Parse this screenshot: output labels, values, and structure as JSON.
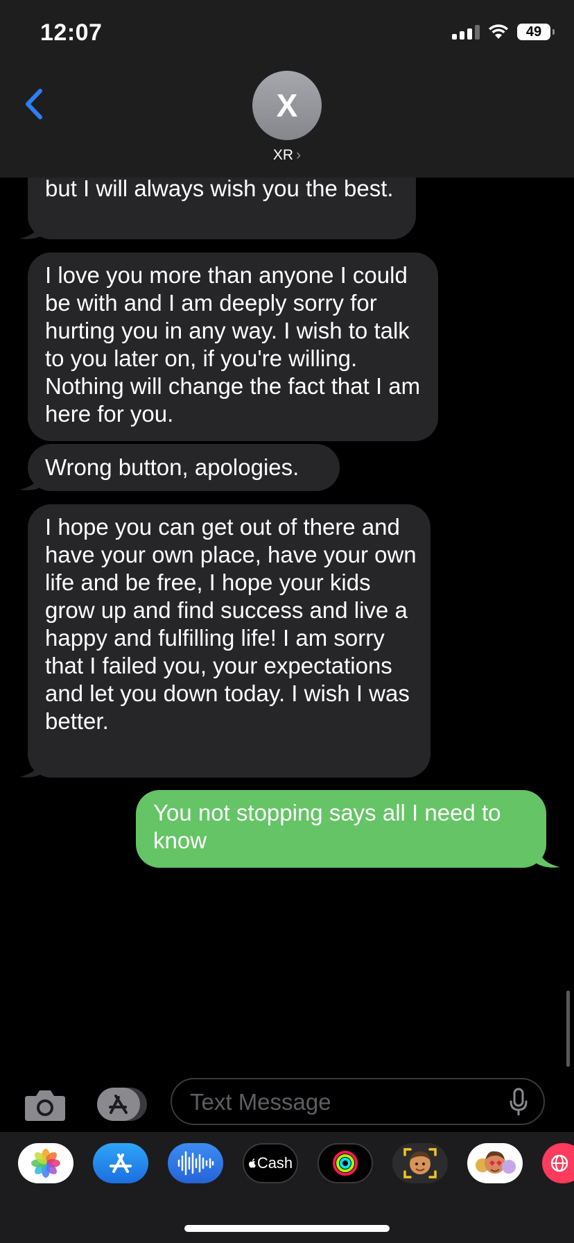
{
  "status_bar": {
    "time": "12:07",
    "battery": "49"
  },
  "header": {
    "avatar_initial": "X",
    "contact_name": "XR",
    "chevron": "›"
  },
  "messages": [
    {
      "direction": "incoming",
      "text": "but I will always wish you the best."
    },
    {
      "direction": "incoming",
      "text": "I love you more than anyone I could be with and I am deeply sorry for hurting you in any way. I wish to talk to you later on, if you're willing. Nothing will change the fact that I am here for you."
    },
    {
      "direction": "incoming",
      "text": "Wrong button, apologies."
    },
    {
      "direction": "incoming",
      "text": "I hope you can get out of there and have your own place, have your own life and be free, I hope your kids grow up and find success and live a happy and fulfilling life! I am sorry that I failed you, your expectations and let you down today. I wish I was better."
    },
    {
      "direction": "outgoing",
      "text": "You not stopping says all I need to know"
    }
  ],
  "input": {
    "placeholder": "Text Message"
  },
  "app_tray": [
    {
      "name": "photos-app-icon"
    },
    {
      "name": "app-store-icon"
    },
    {
      "name": "audio-message-icon"
    },
    {
      "name": "apple-cash-icon",
      "label": "Cash"
    },
    {
      "name": "fitness-activity-icon"
    },
    {
      "name": "memoji-icon"
    },
    {
      "name": "memoji-stickers-icon"
    },
    {
      "name": "web-images-icon"
    }
  ],
  "colors": {
    "incoming_bubble": "#262628",
    "outgoing_bubble": "#65c466",
    "accent": "#2f7cf6",
    "background": "#000000",
    "header": "#1e1e1f"
  }
}
